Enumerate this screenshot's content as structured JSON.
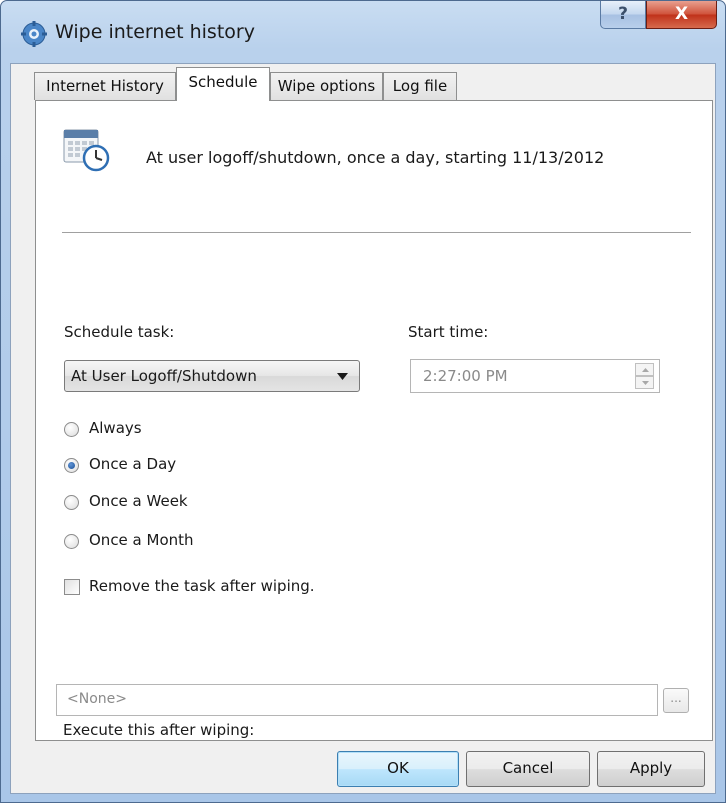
{
  "window": {
    "title": "Wipe internet history",
    "help_glyph": "?",
    "close_glyph": "X"
  },
  "tabs": [
    {
      "label": "Internet History"
    },
    {
      "label": "Schedule"
    },
    {
      "label": "Wipe options"
    },
    {
      "label": "Log file"
    }
  ],
  "schedule": {
    "summary": "At user logoff/shutdown, once a day, starting 11/13/2012",
    "task_label": "Schedule task:",
    "task_value": "At User Logoff/Shutdown",
    "start_label": "Start time:",
    "start_value": "2:27:00 PM",
    "frequencies": [
      {
        "label": "Always",
        "checked": false
      },
      {
        "label": "Once a Day",
        "checked": true
      },
      {
        "label": "Once a Week",
        "checked": false
      },
      {
        "label": "Once a Month",
        "checked": false
      }
    ],
    "remove_task_label": "Remove the task after wiping.",
    "remove_task_checked": false,
    "execute_label": "Execute this after wiping:",
    "execute_value": "<None>",
    "browse_label": "..."
  },
  "buttons": {
    "ok": "OK",
    "cancel": "Cancel",
    "apply": "Apply"
  }
}
